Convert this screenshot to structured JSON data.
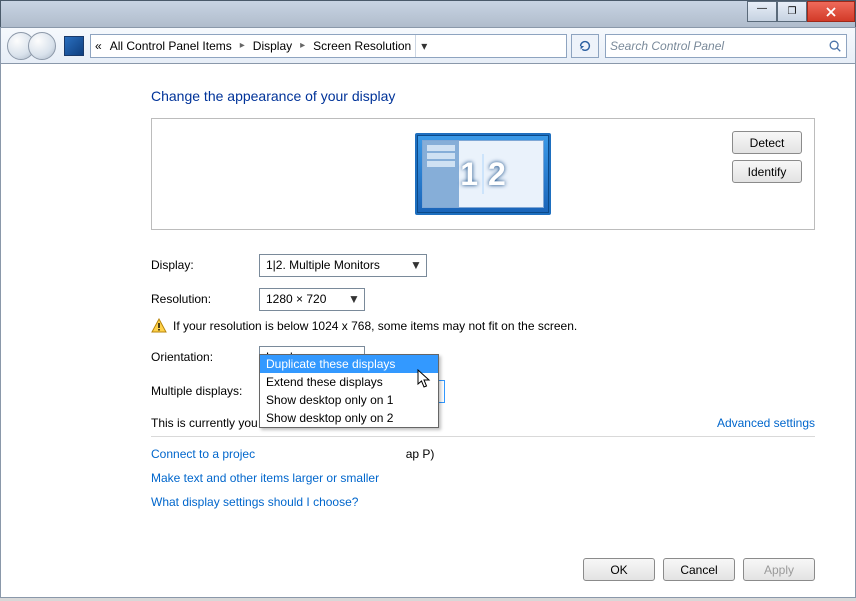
{
  "window": {
    "min_tip": "_",
    "max_tip": "□"
  },
  "breadcrumbs": {
    "root_glyph": "«",
    "items": [
      "All Control Panel Items",
      "Display",
      "Screen Resolution"
    ]
  },
  "search": {
    "placeholder": "Search Control Panel"
  },
  "heading": "Change the appearance of your display",
  "preview": {
    "detect_label": "Detect",
    "identify_label": "Identify",
    "monitor_a_num": "1",
    "monitor_b_num": "2"
  },
  "fields": {
    "display_label": "Display:",
    "display_value": "1|2. Multiple Monitors",
    "resolution_label": "Resolution:",
    "resolution_value": "1280 × 720",
    "resolution_warning": "If your resolution is below 1024 x 768, some items may not fit on the screen.",
    "orientation_label": "Orientation:",
    "orientation_value": "Landscape",
    "multiple_label": "Multiple displays:",
    "multiple_value": "Duplicate these displays",
    "multiple_options": [
      "Duplicate these displays",
      "Extend these displays",
      "Show desktop only on 1",
      "Show desktop only on 2"
    ],
    "multiple_selected_index": 0
  },
  "info": {
    "main_display_partial": "This is currently you",
    "projector_partial_left": "Connect to a projec",
    "projector_partial_right": "ap P)",
    "advanced_link": "Advanced settings",
    "text_size_link": "Make text and other items larger or smaller",
    "help_link": "What display settings should I choose?"
  },
  "buttons": {
    "ok": "OK",
    "cancel": "Cancel",
    "apply": "Apply"
  }
}
